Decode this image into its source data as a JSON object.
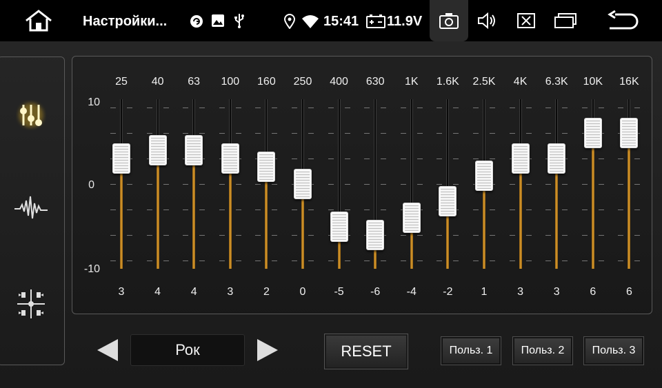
{
  "status_bar": {
    "title": "Настройки...",
    "time": "15:41",
    "voltage": "11.9V",
    "icons": [
      "home-icon",
      "sync-icon",
      "image-icon",
      "usb-icon",
      "location-icon",
      "wifi-icon",
      "battery-icon",
      "camera-icon",
      "volume-icon",
      "close-box-icon",
      "recent-apps-icon",
      "back-icon"
    ]
  },
  "sidebar": {
    "items": [
      {
        "name": "equalizer-icon",
        "active": true
      },
      {
        "name": "waveform-icon",
        "active": false
      },
      {
        "name": "balance-fader-icon",
        "active": false
      }
    ]
  },
  "equalizer": {
    "axis": {
      "top": "10",
      "mid": "0",
      "bottom": "-10",
      "min": -10,
      "max": 10
    },
    "bands": [
      {
        "freq": "25",
        "value": 3
      },
      {
        "freq": "40",
        "value": 4
      },
      {
        "freq": "63",
        "value": 4
      },
      {
        "freq": "100",
        "value": 3
      },
      {
        "freq": "160",
        "value": 2
      },
      {
        "freq": "250",
        "value": 0
      },
      {
        "freq": "400",
        "value": -5
      },
      {
        "freq": "630",
        "value": -6
      },
      {
        "freq": "1K",
        "value": -4
      },
      {
        "freq": "1.6K",
        "value": -2
      },
      {
        "freq": "2.5K",
        "value": 1
      },
      {
        "freq": "4K",
        "value": 3
      },
      {
        "freq": "6.3K",
        "value": 3
      },
      {
        "freq": "10K",
        "value": 6
      },
      {
        "freq": "16K",
        "value": 6
      }
    ]
  },
  "controls": {
    "preset": "Рок",
    "reset_label": "RESET",
    "user_presets": [
      "Польз. 1",
      "Польз. 2",
      "Польз. 3"
    ]
  },
  "colors": {
    "accent": "#e8b030",
    "icon_active": "#ffe680"
  }
}
